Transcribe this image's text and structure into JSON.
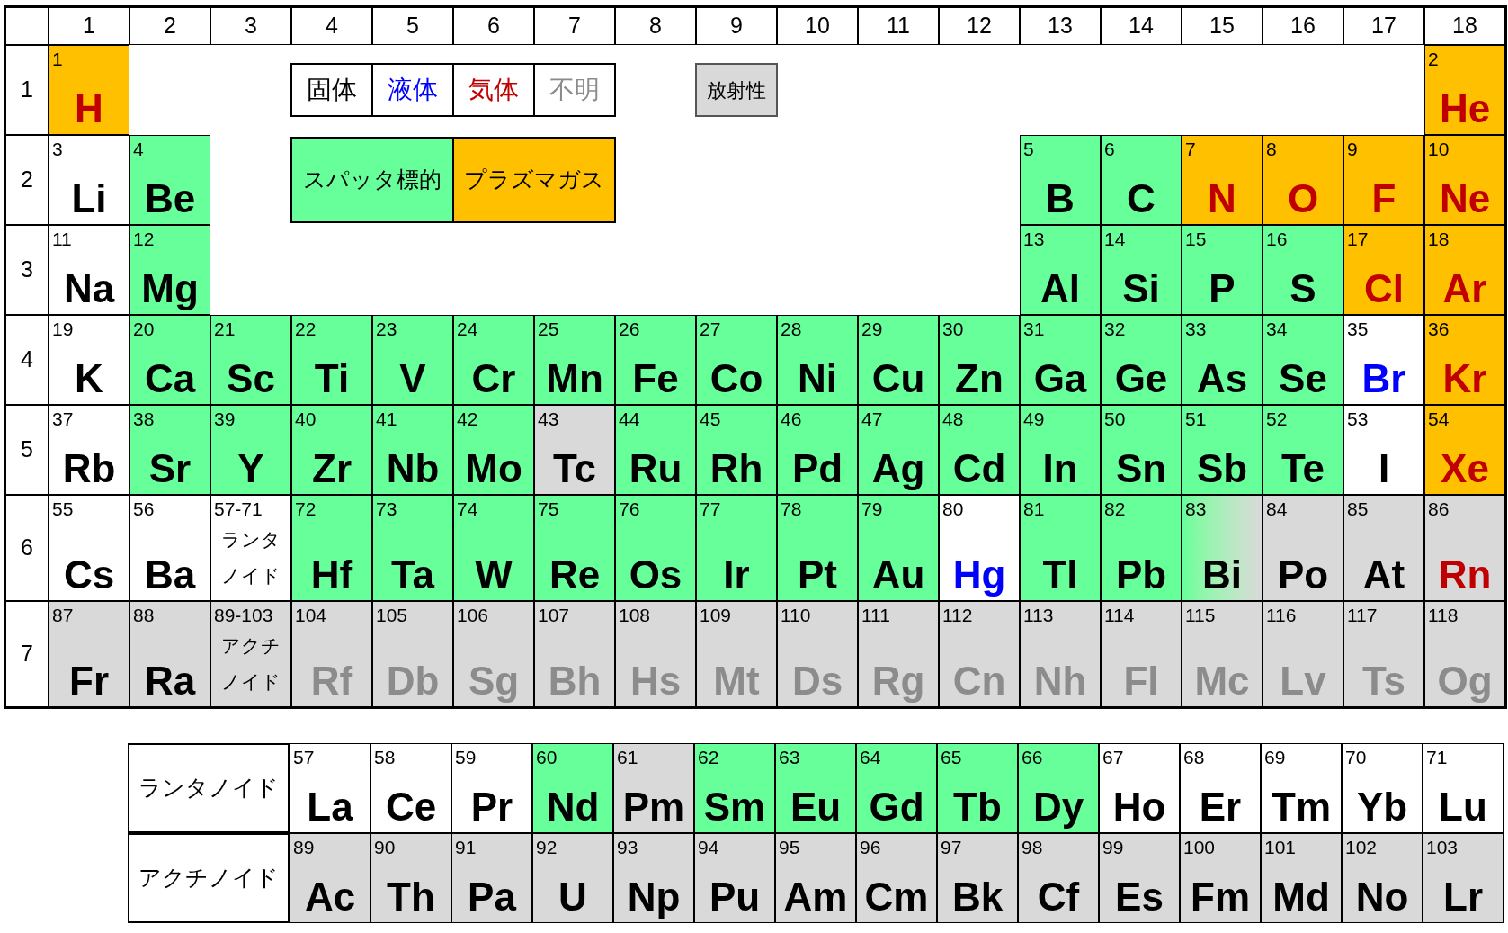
{
  "columns": [
    "1",
    "2",
    "3",
    "4",
    "5",
    "6",
    "7",
    "8",
    "9",
    "10",
    "11",
    "12",
    "13",
    "14",
    "15",
    "16",
    "17",
    "18"
  ],
  "periods": [
    {
      "label": "1",
      "cells": [
        {
          "number": "1",
          "symbol": "H",
          "color": "#c00000",
          "kind": "plasma"
        },
        {
          "number": "2",
          "symbol": "He",
          "color": "#c00000",
          "kind": "plasma"
        }
      ]
    },
    {
      "label": "2",
      "cells": [
        {
          "number": "3",
          "symbol": "Li",
          "color": "#000000",
          "kind": "plain"
        },
        {
          "number": "4",
          "symbol": "Be",
          "color": "#000000",
          "kind": "target"
        },
        {
          "number": "5",
          "symbol": "B",
          "color": "#000000",
          "kind": "target"
        },
        {
          "number": "6",
          "symbol": "C",
          "color": "#000000",
          "kind": "target"
        },
        {
          "number": "7",
          "symbol": "N",
          "color": "#c00000",
          "kind": "plasma"
        },
        {
          "number": "8",
          "symbol": "O",
          "color": "#c00000",
          "kind": "plasma"
        },
        {
          "number": "9",
          "symbol": "F",
          "color": "#c00000",
          "kind": "plasma"
        },
        {
          "number": "10",
          "symbol": "Ne",
          "color": "#c00000",
          "kind": "plasma"
        }
      ]
    },
    {
      "label": "3",
      "cells": [
        {
          "number": "11",
          "symbol": "Na",
          "color": "#000000",
          "kind": "plain"
        },
        {
          "number": "12",
          "symbol": "Mg",
          "color": "#000000",
          "kind": "target"
        },
        {
          "number": "13",
          "symbol": "Al",
          "color": "#000000",
          "kind": "target"
        },
        {
          "number": "14",
          "symbol": "Si",
          "color": "#000000",
          "kind": "target"
        },
        {
          "number": "15",
          "symbol": "P",
          "color": "#000000",
          "kind": "target"
        },
        {
          "number": "16",
          "symbol": "S",
          "color": "#000000",
          "kind": "target"
        },
        {
          "number": "17",
          "symbol": "Cl",
          "color": "#c00000",
          "kind": "plasma"
        },
        {
          "number": "18",
          "symbol": "Ar",
          "color": "#c00000",
          "kind": "plasma"
        }
      ]
    },
    {
      "label": "4",
      "cells": [
        {
          "number": "19",
          "symbol": "K",
          "color": "#000000",
          "kind": "plain"
        },
        {
          "number": "20",
          "symbol": "Ca",
          "color": "#000000",
          "kind": "target"
        },
        {
          "number": "21",
          "symbol": "Sc",
          "color": "#000000",
          "kind": "target"
        },
        {
          "number": "22",
          "symbol": "Ti",
          "color": "#000000",
          "kind": "target"
        },
        {
          "number": "23",
          "symbol": "V",
          "color": "#000000",
          "kind": "target"
        },
        {
          "number": "24",
          "symbol": "Cr",
          "color": "#000000",
          "kind": "target"
        },
        {
          "number": "25",
          "symbol": "Mn",
          "color": "#000000",
          "kind": "target"
        },
        {
          "number": "26",
          "symbol": "Fe",
          "color": "#000000",
          "kind": "target"
        },
        {
          "number": "27",
          "symbol": "Co",
          "color": "#000000",
          "kind": "target"
        },
        {
          "number": "28",
          "symbol": "Ni",
          "color": "#000000",
          "kind": "target"
        },
        {
          "number": "29",
          "symbol": "Cu",
          "color": "#000000",
          "kind": "target"
        },
        {
          "number": "30",
          "symbol": "Zn",
          "color": "#000000",
          "kind": "target"
        },
        {
          "number": "31",
          "symbol": "Ga",
          "color": "#000000",
          "kind": "target"
        },
        {
          "number": "32",
          "symbol": "Ge",
          "color": "#000000",
          "kind": "target"
        },
        {
          "number": "33",
          "symbol": "As",
          "color": "#000000",
          "kind": "target"
        },
        {
          "number": "34",
          "symbol": "Se",
          "color": "#000000",
          "kind": "target"
        },
        {
          "number": "35",
          "symbol": "Br",
          "color": "#0000ff",
          "kind": "plain"
        },
        {
          "number": "36",
          "symbol": "Kr",
          "color": "#c00000",
          "kind": "plasma"
        }
      ]
    },
    {
      "label": "5",
      "cells": [
        {
          "number": "37",
          "symbol": "Rb",
          "color": "#000000",
          "kind": "plain"
        },
        {
          "number": "38",
          "symbol": "Sr",
          "color": "#000000",
          "kind": "target"
        },
        {
          "number": "39",
          "symbol": "Y",
          "color": "#000000",
          "kind": "target"
        },
        {
          "number": "40",
          "symbol": "Zr",
          "color": "#000000",
          "kind": "target"
        },
        {
          "number": "41",
          "symbol": "Nb",
          "color": "#000000",
          "kind": "target"
        },
        {
          "number": "42",
          "symbol": "Mo",
          "color": "#000000",
          "kind": "target"
        },
        {
          "number": "43",
          "symbol": "Tc",
          "color": "#000000",
          "kind": "radioactive"
        },
        {
          "number": "44",
          "symbol": "Ru",
          "color": "#000000",
          "kind": "target"
        },
        {
          "number": "45",
          "symbol": "Rh",
          "color": "#000000",
          "kind": "target"
        },
        {
          "number": "46",
          "symbol": "Pd",
          "color": "#000000",
          "kind": "target"
        },
        {
          "number": "47",
          "symbol": "Ag",
          "color": "#000000",
          "kind": "target"
        },
        {
          "number": "48",
          "symbol": "Cd",
          "color": "#000000",
          "kind": "target"
        },
        {
          "number": "49",
          "symbol": "In",
          "color": "#000000",
          "kind": "target"
        },
        {
          "number": "50",
          "symbol": "Sn",
          "color": "#000000",
          "kind": "target"
        },
        {
          "number": "51",
          "symbol": "Sb",
          "color": "#000000",
          "kind": "target"
        },
        {
          "number": "52",
          "symbol": "Te",
          "color": "#000000",
          "kind": "target"
        },
        {
          "number": "53",
          "symbol": "I",
          "color": "#000000",
          "kind": "plain"
        },
        {
          "number": "54",
          "symbol": "Xe",
          "color": "#c00000",
          "kind": "plasma"
        }
      ]
    },
    {
      "label": "6",
      "cells": [
        {
          "number": "55",
          "symbol": "Cs",
          "color": "#000000",
          "kind": "plain"
        },
        {
          "number": "56",
          "symbol": "Ba",
          "color": "#000000",
          "kind": "plain"
        },
        {
          "number": "57-71",
          "name": "ランタノイド",
          "kind": "plain"
        },
        {
          "number": "72",
          "symbol": "Hf",
          "color": "#000000",
          "kind": "target"
        },
        {
          "number": "73",
          "symbol": "Ta",
          "color": "#000000",
          "kind": "target"
        },
        {
          "number": "74",
          "symbol": "W",
          "color": "#000000",
          "kind": "target"
        },
        {
          "number": "75",
          "symbol": "Re",
          "color": "#000000",
          "kind": "target"
        },
        {
          "number": "76",
          "symbol": "Os",
          "color": "#000000",
          "kind": "target"
        },
        {
          "number": "77",
          "symbol": "Ir",
          "color": "#000000",
          "kind": "target"
        },
        {
          "number": "78",
          "symbol": "Pt",
          "color": "#000000",
          "kind": "target"
        },
        {
          "number": "79",
          "symbol": "Au",
          "color": "#000000",
          "kind": "target"
        },
        {
          "number": "80",
          "symbol": "Hg",
          "color": "#0000ff",
          "kind": "plain"
        },
        {
          "number": "81",
          "symbol": "Tl",
          "color": "#000000",
          "kind": "target"
        },
        {
          "number": "82",
          "symbol": "Pb",
          "color": "#000000",
          "kind": "target"
        },
        {
          "number": "83",
          "symbol": "Bi",
          "color": "#000000",
          "kind": "mixed"
        },
        {
          "number": "84",
          "symbol": "Po",
          "color": "#000000",
          "kind": "radioactive"
        },
        {
          "number": "85",
          "symbol": "At",
          "color": "#000000",
          "kind": "radioactive"
        },
        {
          "number": "86",
          "symbol": "Rn",
          "color": "#c00000",
          "kind": "radioactive"
        }
      ]
    },
    {
      "label": "7",
      "cells": [
        {
          "number": "87",
          "symbol": "Fr",
          "color": "#000000",
          "kind": "radioactive"
        },
        {
          "number": "88",
          "symbol": "Ra",
          "color": "#000000",
          "kind": "radioactive"
        },
        {
          "number": "89-103",
          "name": "アクチノイド",
          "kind": "radioactive"
        },
        {
          "number": "104",
          "symbol": "Rf",
          "color": "#8c8c8c",
          "kind": "radioactive"
        },
        {
          "number": "105",
          "symbol": "Db",
          "color": "#8c8c8c",
          "kind": "radioactive"
        },
        {
          "number": "106",
          "symbol": "Sg",
          "color": "#8c8c8c",
          "kind": "radioactive"
        },
        {
          "number": "107",
          "symbol": "Bh",
          "color": "#8c8c8c",
          "kind": "radioactive"
        },
        {
          "number": "108",
          "symbol": "Hs",
          "color": "#8c8c8c",
          "kind": "radioactive"
        },
        {
          "number": "109",
          "symbol": "Mt",
          "color": "#8c8c8c",
          "kind": "radioactive"
        },
        {
          "number": "110",
          "symbol": "Ds",
          "color": "#8c8c8c",
          "kind": "radioactive"
        },
        {
          "number": "111",
          "symbol": "Rg",
          "color": "#8c8c8c",
          "kind": "radioactive"
        },
        {
          "number": "112",
          "symbol": "Cn",
          "color": "#8c8c8c",
          "kind": "radioactive"
        },
        {
          "number": "113",
          "symbol": "Nh",
          "color": "#8c8c8c",
          "kind": "radioactive"
        },
        {
          "number": "114",
          "symbol": "Fl",
          "color": "#8c8c8c",
          "kind": "radioactive"
        },
        {
          "number": "115",
          "symbol": "Mc",
          "color": "#8c8c8c",
          "kind": "radioactive"
        },
        {
          "number": "116",
          "symbol": "Lv",
          "color": "#8c8c8c",
          "kind": "radioactive"
        },
        {
          "number": "117",
          "symbol": "Ts",
          "color": "#8c8c8c",
          "kind": "radioactive"
        },
        {
          "number": "118",
          "symbol": "Og",
          "color": "#8c8c8c",
          "kind": "radioactive"
        }
      ]
    }
  ],
  "legend": {
    "states": [
      {
        "label": "固体",
        "color": "#000000"
      },
      {
        "label": "液体",
        "color": "#0000ff"
      },
      {
        "label": "気体",
        "color": "#c00000"
      },
      {
        "label": "不明",
        "color": "#8c8c8c"
      }
    ],
    "radioactive": {
      "label": "放射性"
    },
    "categories": [
      {
        "label": "スパッタ標的",
        "kind": "target"
      },
      {
        "label": "プラズマガス",
        "kind": "plasma"
      }
    ]
  },
  "series_rows": [
    {
      "label": "ランタノイド",
      "cells": [
        {
          "number": "57",
          "symbol": "La",
          "color": "#000000",
          "kind": "plain"
        },
        {
          "number": "58",
          "symbol": "Ce",
          "color": "#000000",
          "kind": "plain"
        },
        {
          "number": "59",
          "symbol": "Pr",
          "color": "#000000",
          "kind": "plain"
        },
        {
          "number": "60",
          "symbol": "Nd",
          "color": "#000000",
          "kind": "target"
        },
        {
          "number": "61",
          "symbol": "Pm",
          "color": "#000000",
          "kind": "radioactive"
        },
        {
          "number": "62",
          "symbol": "Sm",
          "color": "#000000",
          "kind": "target"
        },
        {
          "number": "63",
          "symbol": "Eu",
          "color": "#000000",
          "kind": "target"
        },
        {
          "number": "64",
          "symbol": "Gd",
          "color": "#000000",
          "kind": "target"
        },
        {
          "number": "65",
          "symbol": "Tb",
          "color": "#000000",
          "kind": "target"
        },
        {
          "number": "66",
          "symbol": "Dy",
          "color": "#000000",
          "kind": "target"
        },
        {
          "number": "67",
          "symbol": "Ho",
          "color": "#000000",
          "kind": "plain"
        },
        {
          "number": "68",
          "symbol": "Er",
          "color": "#000000",
          "kind": "plain"
        },
        {
          "number": "69",
          "symbol": "Tm",
          "color": "#000000",
          "kind": "plain"
        },
        {
          "number": "70",
          "symbol": "Yb",
          "color": "#000000",
          "kind": "plain"
        },
        {
          "number": "71",
          "symbol": "Lu",
          "color": "#000000",
          "kind": "plain"
        }
      ]
    },
    {
      "label": "アクチノイド",
      "cells": [
        {
          "number": "89",
          "symbol": "Ac",
          "color": "#000000",
          "kind": "radioactive"
        },
        {
          "number": "90",
          "symbol": "Th",
          "color": "#000000",
          "kind": "radioactive"
        },
        {
          "number": "91",
          "symbol": "Pa",
          "color": "#000000",
          "kind": "radioactive"
        },
        {
          "number": "92",
          "symbol": "U",
          "color": "#000000",
          "kind": "radioactive"
        },
        {
          "number": "93",
          "symbol": "Np",
          "color": "#000000",
          "kind": "radioactive"
        },
        {
          "number": "94",
          "symbol": "Pu",
          "color": "#000000",
          "kind": "radioactive"
        },
        {
          "number": "95",
          "symbol": "Am",
          "color": "#000000",
          "kind": "radioactive"
        },
        {
          "number": "96",
          "symbol": "Cm",
          "color": "#000000",
          "kind": "radioactive"
        },
        {
          "number": "97",
          "symbol": "Bk",
          "color": "#000000",
          "kind": "radioactive"
        },
        {
          "number": "98",
          "symbol": "Cf",
          "color": "#000000",
          "kind": "radioactive"
        },
        {
          "number": "99",
          "symbol": "Es",
          "color": "#000000",
          "kind": "radioactive"
        },
        {
          "number": "100",
          "symbol": "Fm",
          "color": "#000000",
          "kind": "radioactive"
        },
        {
          "number": "101",
          "symbol": "Md",
          "color": "#000000",
          "kind": "radioactive"
        },
        {
          "number": "102",
          "symbol": "No",
          "color": "#000000",
          "kind": "radioactive"
        },
        {
          "number": "103",
          "symbol": "Lr",
          "color": "#000000",
          "kind": "radioactive"
        }
      ]
    }
  ]
}
